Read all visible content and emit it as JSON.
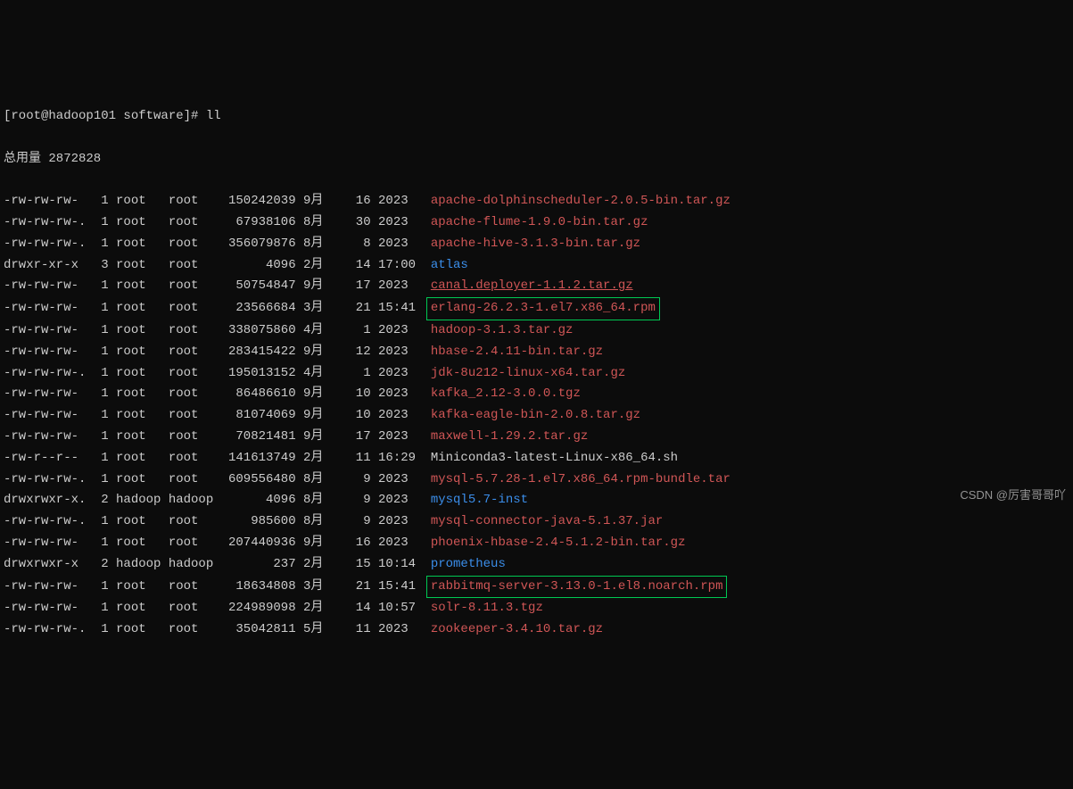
{
  "header": {
    "line0": "[root@hadoop101 software]# ll",
    "total_label": "总用量 2872828"
  },
  "files": [
    {
      "perms": "-rw-rw-rw-",
      "dot": " ",
      "links": "1",
      "owner": "root",
      "group": "root",
      "size": "150242039",
      "month": "9月",
      "day": "16",
      "time": "2023",
      "name": "apache-dolphinscheduler-2.0.5-bin.tar.gz",
      "cls": "c-red",
      "box": false
    },
    {
      "perms": "-rw-rw-rw-",
      "dot": ".",
      "links": "1",
      "owner": "root",
      "group": "root",
      "size": "67938106",
      "month": "8月",
      "day": "30",
      "time": "2023",
      "name": "apache-flume-1.9.0-bin.tar.gz",
      "cls": "c-red",
      "box": false
    },
    {
      "perms": "-rw-rw-rw-",
      "dot": ".",
      "links": "1",
      "owner": "root",
      "group": "root",
      "size": "356079876",
      "month": "8月",
      "day": "8",
      "time": "2023",
      "name": "apache-hive-3.1.3-bin.tar.gz",
      "cls": "c-red",
      "box": false
    },
    {
      "perms": "drwxr-xr-x",
      "dot": " ",
      "links": "3",
      "owner": "root",
      "group": "root",
      "size": "4096",
      "month": "2月",
      "day": "14",
      "time": "17:00",
      "name": "atlas",
      "cls": "c-blue",
      "box": false
    },
    {
      "perms": "-rw-rw-rw-",
      "dot": " ",
      "links": "1",
      "owner": "root",
      "group": "root",
      "size": "50754847",
      "month": "9月",
      "day": "17",
      "time": "2023",
      "name": "canal.deployer-1.1.2.tar.gz",
      "cls": "c-red-u",
      "box": false
    },
    {
      "perms": "-rw-rw-rw-",
      "dot": " ",
      "links": "1",
      "owner": "root",
      "group": "root",
      "size": "23566684",
      "month": "3月",
      "day": "21",
      "time": "15:41",
      "name": "erlang-26.2.3-1.el7.x86_64.rpm",
      "cls": "c-red",
      "box": true
    },
    {
      "perms": "-rw-rw-rw-",
      "dot": " ",
      "links": "1",
      "owner": "root",
      "group": "root",
      "size": "338075860",
      "month": "4月",
      "day": "1",
      "time": "2023",
      "name": "hadoop-3.1.3.tar.gz",
      "cls": "c-red",
      "box": false
    },
    {
      "perms": "-rw-rw-rw-",
      "dot": " ",
      "links": "1",
      "owner": "root",
      "group": "root",
      "size": "283415422",
      "month": "9月",
      "day": "12",
      "time": "2023",
      "name": "hbase-2.4.11-bin.tar.gz",
      "cls": "c-red",
      "box": false
    },
    {
      "perms": "-rw-rw-rw-",
      "dot": ".",
      "links": "1",
      "owner": "root",
      "group": "root",
      "size": "195013152",
      "month": "4月",
      "day": "1",
      "time": "2023",
      "name": "jdk-8u212-linux-x64.tar.gz",
      "cls": "c-red",
      "box": false
    },
    {
      "perms": "-rw-rw-rw-",
      "dot": " ",
      "links": "1",
      "owner": "root",
      "group": "root",
      "size": "86486610",
      "month": "9月",
      "day": "10",
      "time": "2023",
      "name": "kafka_2.12-3.0.0.tgz",
      "cls": "c-red",
      "box": false
    },
    {
      "perms": "-rw-rw-rw-",
      "dot": " ",
      "links": "1",
      "owner": "root",
      "group": "root",
      "size": "81074069",
      "month": "9月",
      "day": "10",
      "time": "2023",
      "name": "kafka-eagle-bin-2.0.8.tar.gz",
      "cls": "c-red",
      "box": false
    },
    {
      "perms": "-rw-rw-rw-",
      "dot": " ",
      "links": "1",
      "owner": "root",
      "group": "root",
      "size": "70821481",
      "month": "9月",
      "day": "17",
      "time": "2023",
      "name": "maxwell-1.29.2.tar.gz",
      "cls": "c-red",
      "box": false
    },
    {
      "perms": "-rw-r--r--",
      "dot": " ",
      "links": "1",
      "owner": "root",
      "group": "root",
      "size": "141613749",
      "month": "2月",
      "day": "11",
      "time": "16:29",
      "name": "Miniconda3-latest-Linux-x86_64.sh",
      "cls": "c-white",
      "box": false
    },
    {
      "perms": "-rw-rw-rw-",
      "dot": ".",
      "links": "1",
      "owner": "root",
      "group": "root",
      "size": "609556480",
      "month": "8月",
      "day": "9",
      "time": "2023",
      "name": "mysql-5.7.28-1.el7.x86_64.rpm-bundle.tar",
      "cls": "c-red",
      "box": false
    },
    {
      "perms": "drwxrwxr-x",
      "dot": ".",
      "links": "2",
      "owner": "hadoop",
      "group": "hadoop",
      "size": "4096",
      "month": "8月",
      "day": "9",
      "time": "2023",
      "name": "mysql5.7-inst",
      "cls": "c-blue",
      "box": false
    },
    {
      "perms": "-rw-rw-rw-",
      "dot": ".",
      "links": "1",
      "owner": "root",
      "group": "root",
      "size": "985600",
      "month": "8月",
      "day": "9",
      "time": "2023",
      "name": "mysql-connector-java-5.1.37.jar",
      "cls": "c-red",
      "box": false
    },
    {
      "perms": "-rw-rw-rw-",
      "dot": " ",
      "links": "1",
      "owner": "root",
      "group": "root",
      "size": "207440936",
      "month": "9月",
      "day": "16",
      "time": "2023",
      "name": "phoenix-hbase-2.4-5.1.2-bin.tar.gz",
      "cls": "c-red",
      "box": false
    },
    {
      "perms": "drwxrwxr-x",
      "dot": " ",
      "links": "2",
      "owner": "hadoop",
      "group": "hadoop",
      "size": "237",
      "month": "2月",
      "day": "15",
      "time": "10:14",
      "name": "prometheus",
      "cls": "c-blue",
      "box": false
    },
    {
      "perms": "-rw-rw-rw-",
      "dot": " ",
      "links": "1",
      "owner": "root",
      "group": "root",
      "size": "18634808",
      "month": "3月",
      "day": "21",
      "time": "15:41",
      "name": "rabbitmq-server-3.13.0-1.el8.noarch.rpm",
      "cls": "c-red",
      "box": true
    },
    {
      "perms": "-rw-rw-rw-",
      "dot": " ",
      "links": "1",
      "owner": "root",
      "group": "root",
      "size": "224989098",
      "month": "2月",
      "day": "14",
      "time": "10:57",
      "name": "solr-8.11.3.tgz",
      "cls": "c-red",
      "box": false
    },
    {
      "perms": "-rw-rw-rw-",
      "dot": ".",
      "links": "1",
      "owner": "root",
      "group": "root",
      "size": "35042811",
      "month": "5月",
      "day": "11",
      "time": "2023",
      "name": "zookeeper-3.4.10.tar.gz",
      "cls": "c-red",
      "box": false
    }
  ],
  "watermark": "CSDN @厉害哥哥吖"
}
